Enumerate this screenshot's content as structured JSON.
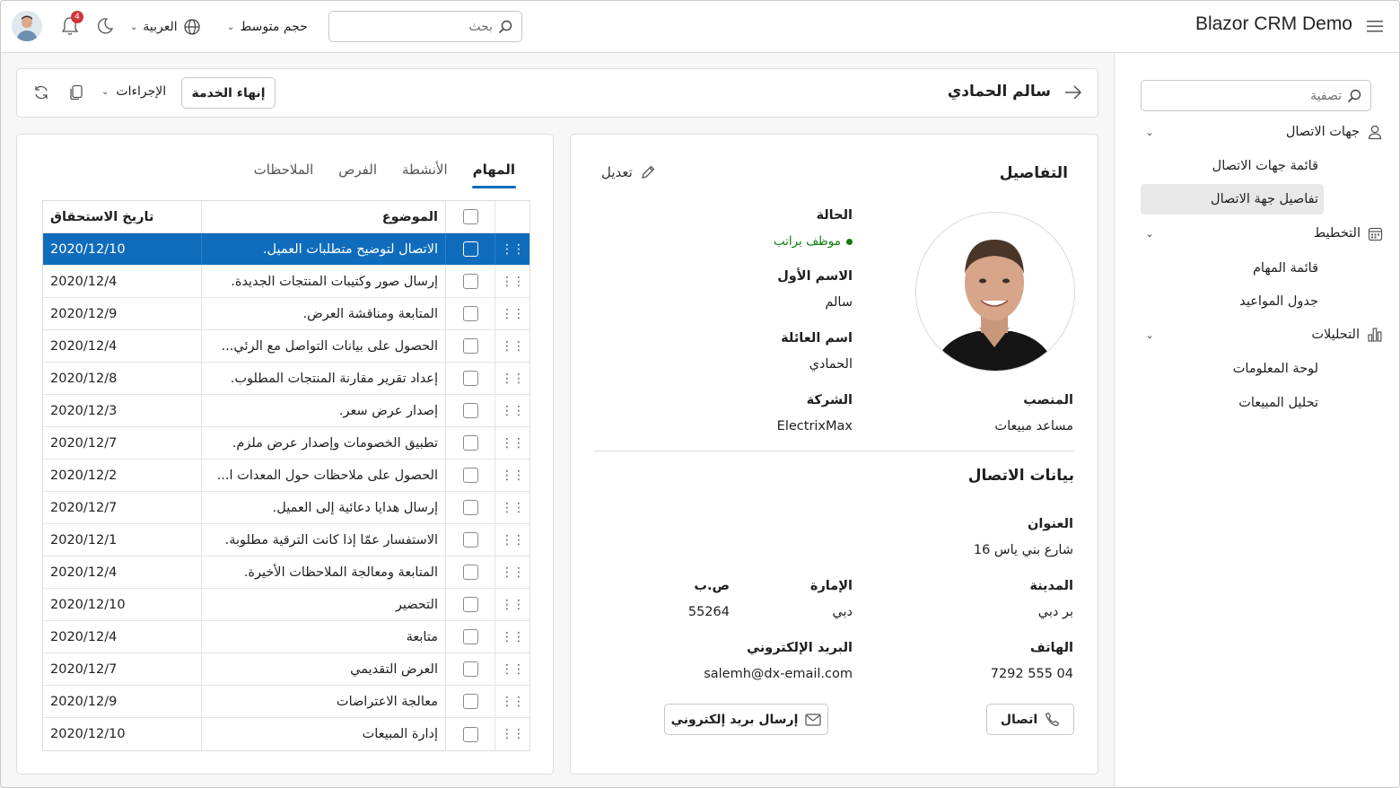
{
  "header": {
    "app_title": "Blazor CRM Demo",
    "search_placeholder": "بحث",
    "size_label": "حجم متوسط",
    "language_label": "العربية",
    "notifications_count": "4"
  },
  "sidebar": {
    "filter_placeholder": "تصفية",
    "groups": [
      {
        "label": "جهات الاتصال",
        "items": [
          "قائمة جهات الاتصال",
          "تفاصيل جهة الاتصال"
        ]
      },
      {
        "label": "التخطيط",
        "items": [
          "قائمة المهام",
          "جدول المواعيد"
        ]
      },
      {
        "label": "التحليلات",
        "items": [
          "لوحة المعلومات",
          "تحليل المبيعات"
        ]
      }
    ],
    "active_item": "تفاصيل جهة الاتصال"
  },
  "toolbar": {
    "contact_name": "سالم الحمادي",
    "end_service_label": "إنهاء الخدمة",
    "actions_label": "الإجراءات"
  },
  "details": {
    "title": "التفاصيل",
    "edit_label": "تعديل",
    "status_label": "الحالة",
    "status_value": "موظف براتب",
    "first_name_label": "الاسم الأول",
    "first_name_value": "سالم",
    "last_name_label": "اسم العائلة",
    "last_name_value": "الحمادي",
    "position_label": "المنصب",
    "position_value": "مساعد مبيعات",
    "company_label": "الشركة",
    "company_value": "ElectrixMax",
    "contact_title": "بيانات الاتصال",
    "address_label": "العنوان",
    "address_value": "شارع بني ياس 16",
    "city_label": "المدينة",
    "city_value": "بر دبي",
    "emirate_label": "الإمارة",
    "emirate_value": "دبي",
    "po_label": "ص.ب",
    "po_value": "55264",
    "phone_label": "الهاتف",
    "phone_value": "04 555 7292",
    "email_label": "البريد الإلكتروني",
    "email_value": "salemh@dx-email.com",
    "call_label": "اتصال",
    "send_email_label": "إرسال بريد إلكتروني"
  },
  "tasks": {
    "tabs": [
      "المهام",
      "الأنشطة",
      "الفرص",
      "الملاحظات"
    ],
    "columns": {
      "subject": "الموضوع",
      "due_date": "تاريخ الاستحقاق"
    },
    "rows": [
      {
        "subject": "الاتصال لتوضيح متطلبات العميل.",
        "date": "2020/12/10"
      },
      {
        "subject": "إرسال صور وكتيبات المنتجات الجديدة.",
        "date": "2020/12/4"
      },
      {
        "subject": "المتابعة ومناقشة العرض.",
        "date": "2020/12/9"
      },
      {
        "subject": "الحصول على بيانات التواصل مع الرئي...",
        "date": "2020/12/4"
      },
      {
        "subject": "إعداد تقرير مقارنة المنتجات المطلوب.",
        "date": "2020/12/8"
      },
      {
        "subject": "إصدار عرض سعر.",
        "date": "2020/12/3"
      },
      {
        "subject": "تطبيق الخصومات وإصدار عرض ملزم.",
        "date": "2020/12/7"
      },
      {
        "subject": "الحصول على ملاحظات حول المعدات ا...",
        "date": "2020/12/2"
      },
      {
        "subject": "إرسال هدايا دعائية إلى العميل.",
        "date": "2020/12/7"
      },
      {
        "subject": "الاستفسار عمّا إذا كانت الترقية مطلوبة.",
        "date": "2020/12/1"
      },
      {
        "subject": "المتابعة ومعالجة الملاحظات الأخيرة.",
        "date": "2020/12/4"
      },
      {
        "subject": "التحضير",
        "date": "2020/12/10"
      },
      {
        "subject": "متابعة",
        "date": "2020/12/4"
      },
      {
        "subject": "العرض التقديمي",
        "date": "2020/12/7"
      },
      {
        "subject": "معالجة الاعتراضات",
        "date": "2020/12/9"
      },
      {
        "subject": "إدارة المبيعات",
        "date": "2020/12/10"
      }
    ]
  }
}
